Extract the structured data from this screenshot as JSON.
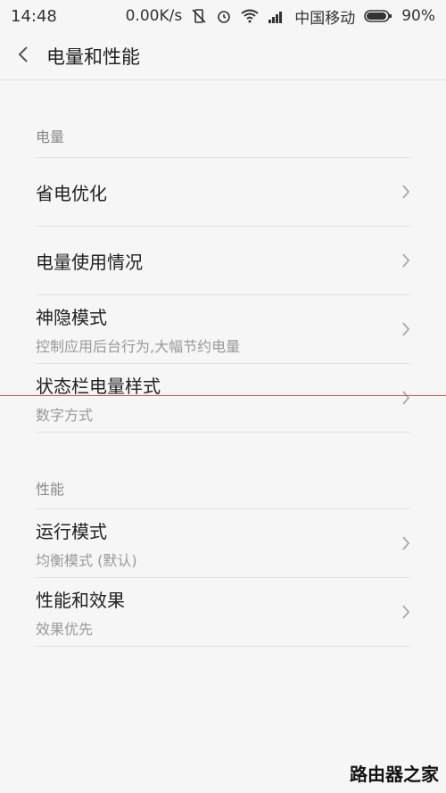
{
  "status_bar": {
    "time": "14:48",
    "speed": "0.00K/s",
    "carrier": "中国移动",
    "battery": "90%"
  },
  "header": {
    "title": "电量和性能"
  },
  "sections": {
    "power": {
      "label": "电量",
      "items": [
        {
          "title": "省电优化"
        },
        {
          "title": "电量使用情况"
        },
        {
          "title": "神隐模式",
          "subtitle": "控制应用后台行为,大幅节约电量"
        },
        {
          "title": "状态栏电量样式",
          "subtitle": "数字方式"
        }
      ]
    },
    "performance": {
      "label": "性能",
      "items": [
        {
          "title": "运行模式",
          "subtitle": "均衡模式 (默认)"
        },
        {
          "title": "性能和效果",
          "subtitle": "效果优先"
        }
      ]
    }
  },
  "watermark": "路由器之家"
}
